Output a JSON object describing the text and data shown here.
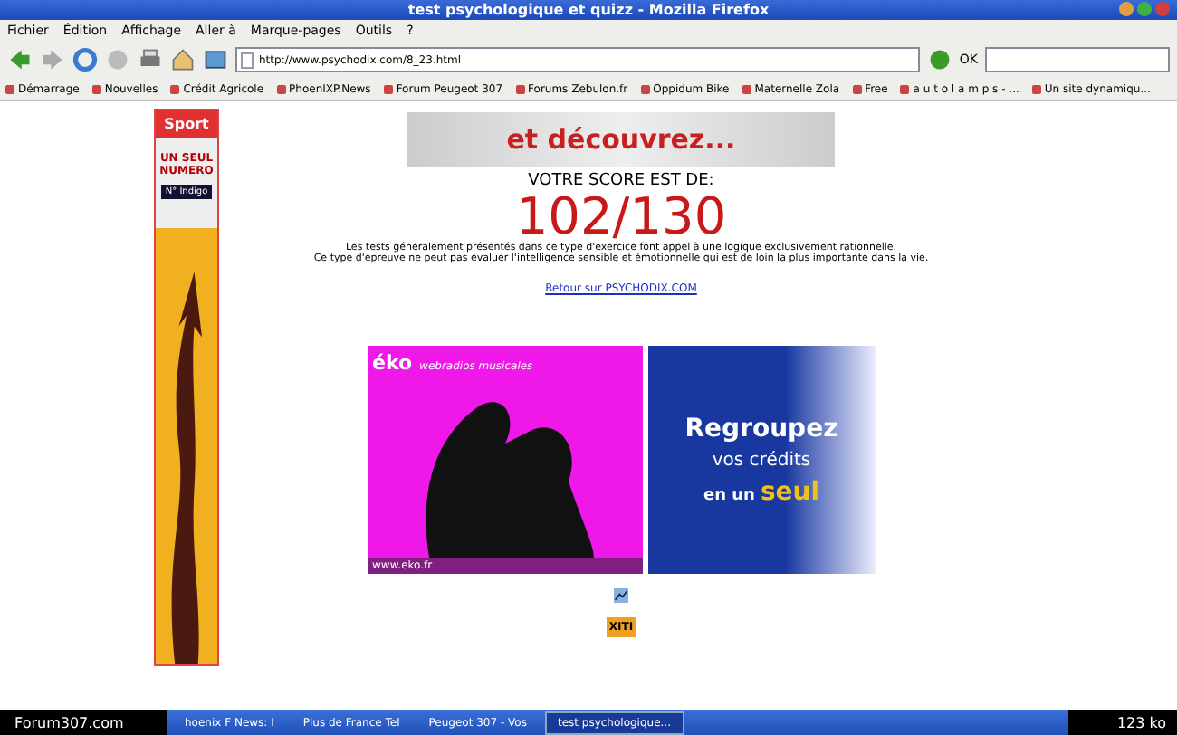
{
  "window": {
    "title": "test psychologique et quizz - Mozilla Firefox"
  },
  "menu": [
    "Fichier",
    "Édition",
    "Affichage",
    "Aller à",
    "Marque-pages",
    "Outils",
    "?"
  ],
  "address_bar": {
    "value": "http://www.psychodix.com/8_23.html",
    "go_label": "OK"
  },
  "bookmarks": [
    "Démarrage",
    "Nouvelles",
    "Crédit Agricole",
    "PhoenIXP.News",
    "Forum Peugeot 307",
    "Forums Zebulon.fr",
    "Oppidum Bike",
    "Maternelle Zola",
    "Free",
    "a u t o l a m p s - ...",
    "Un site dynamiqu..."
  ],
  "side_ad": {
    "brand": "Sport",
    "headline": "UN SEUL NUMERO",
    "badge": "N° Indigo"
  },
  "top_banner": {
    "text": "et découvrez..."
  },
  "score": {
    "heading": "VOTRE SCORE EST DE:",
    "value": "102/130"
  },
  "paragraph": [
    "Les tests généralement présentés dans ce type d'exercice font appel à une logique exclusivement rationnelle.",
    "Ce type d'épreuve ne peut pas évaluer l'intelligence sensible et émotionnelle qui est de loin la plus importante dans la vie."
  ],
  "link": "Retour sur PSYCHODIX.COM",
  "radio_ad": {
    "logo": "éko",
    "tagline": "webradios musicales",
    "url": "www.eko.fr"
  },
  "credit_ad": {
    "line_1": "Regroupez",
    "line_2": "vos crédits",
    "line_3": "en un",
    "line_4": "seul"
  },
  "counter_badge": "XITI",
  "taskbar": {
    "start": "Forum307.com",
    "tasks": [
      {
        "label": "hoenix F News: I",
        "selected": false
      },
      {
        "label": "Plus de France Tel",
        "selected": false
      },
      {
        "label": "Peugeot 307 - Vos",
        "selected": false
      },
      {
        "label": "test psychologique...",
        "selected": true
      }
    ],
    "status": "123 ko"
  }
}
